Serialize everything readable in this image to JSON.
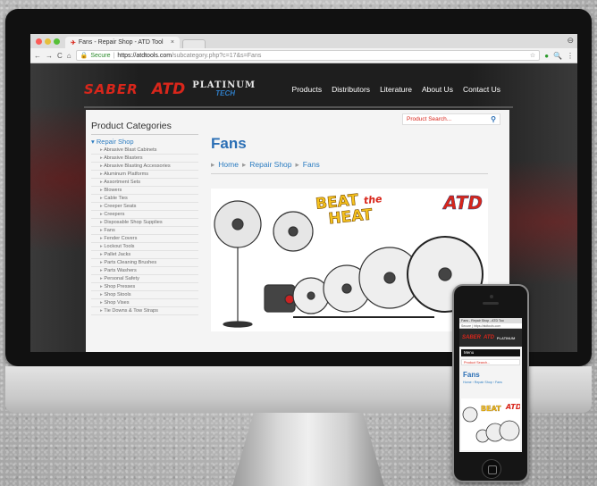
{
  "browser": {
    "tab_title": "Fans - Repair Shop - ATD Tool",
    "close_glyph": "×",
    "url_secure_label": "Secure",
    "url_domain": "https://atdtools.com",
    "url_path": "/subcategory.php?c=17&s=Fans"
  },
  "nav": {
    "logo_saber": "SABER",
    "logo_atd": "ATD",
    "logo_platinum": "PLATINUM",
    "logo_tech": "TECH",
    "menu": [
      "Products",
      "Distributors",
      "Literature",
      "About Us",
      "Contact Us"
    ]
  },
  "sidebar": {
    "heading": "Product Categories",
    "parent": "Repair Shop",
    "items": [
      "Abrasive Blast Cabinets",
      "Abrasive Blasters",
      "Abrasive Blasting Accessories",
      "Aluminum Platforms",
      "Assortment Sets",
      "Blowers",
      "Cable Ties",
      "Creeper Seats",
      "Creepers",
      "Disposable Shop Supplies",
      "Fans",
      "Fender Covers",
      "Lockout Tools",
      "Pallet Jacks",
      "Parts Cleaning Brushes",
      "Parts Washers",
      "Personal Safety",
      "Shop Presses",
      "Shop Stools",
      "Shop Vises",
      "Tie Downs & Tow Straps"
    ]
  },
  "search": {
    "placeholder": "Product Search..."
  },
  "main": {
    "title": "Fans",
    "breadcrumb": [
      "Home",
      "Repair Shop",
      "Fans"
    ],
    "hero_line1": "BEAT",
    "hero_the": "the",
    "hero_line2": "HEAT",
    "hero_brand": "ATD"
  },
  "phone": {
    "tab_title": "Fans - Repair Shop - ATD Too",
    "url": "Secure | https://atdtools.com",
    "menu_label": "Menu",
    "search_placeholder": "Product Search...",
    "title": "Fans",
    "breadcrumb": "Home › Repair Shop › Fans"
  },
  "colors": {
    "brand_red": "#d8261b",
    "link_blue": "#2b7cc1",
    "title_blue": "#2b6fb5"
  }
}
